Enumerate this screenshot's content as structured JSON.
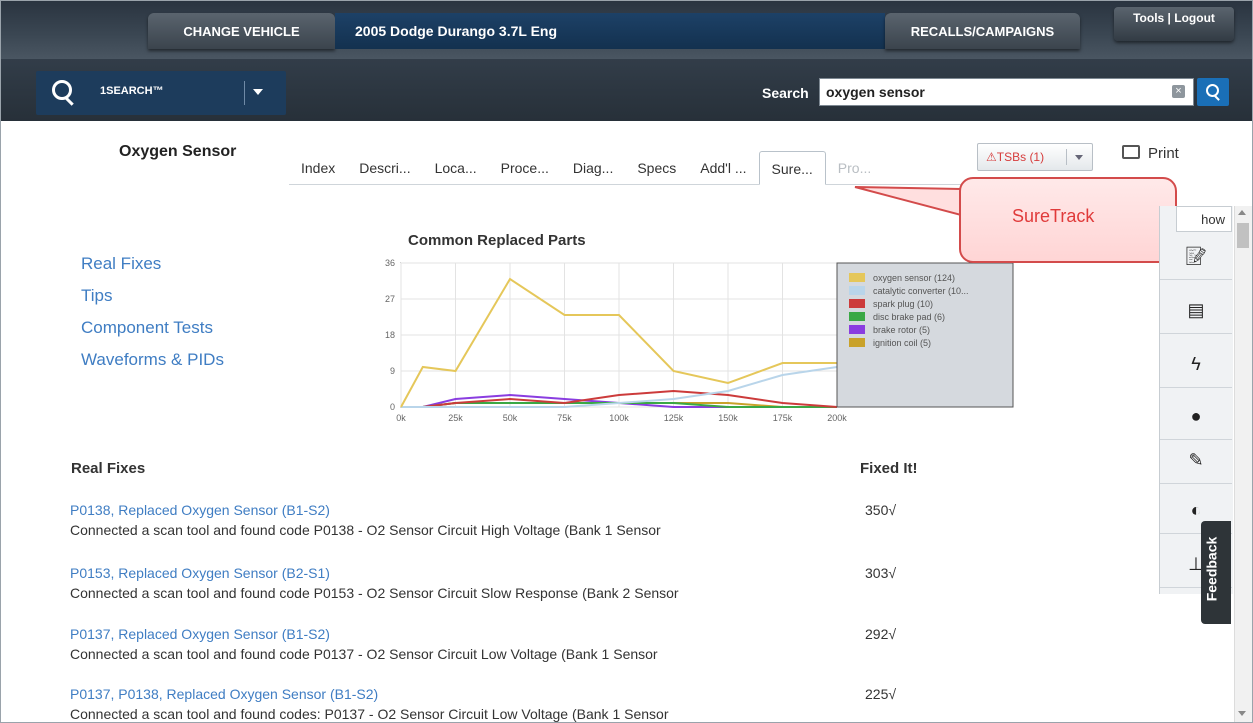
{
  "header": {
    "change_vehicle": "CHANGE VEHICLE",
    "vehicle": "2005 Dodge Durango 3.7L Eng",
    "recalls": "RECALLS/CAMPAIGNS",
    "tools_logout": "Tools | Logout"
  },
  "search": {
    "onesearch_label": "1SEARCH™",
    "label": "Search",
    "value": "oxygen sensor",
    "clear_icon": "close-icon",
    "button_icon": "search-icon"
  },
  "page": {
    "title": "Oxygen Sensor",
    "tabs": [
      "Index",
      "Descri...",
      "Loca...",
      "Proce...",
      "Diag...",
      "Specs",
      "Add'l ...",
      "Sure...",
      "Pro..."
    ],
    "active_tab": "Sure...",
    "tsbs_label": "TSBs (1)",
    "print_label": "Print"
  },
  "callout": {
    "text": "SureTrack"
  },
  "left_links": [
    "Real Fixes",
    "Tips",
    "Component Tests",
    "Waveforms & PIDs"
  ],
  "right_toolbar": {
    "show_label": "how",
    "icons": [
      "notes-icon",
      "document-icon",
      "flash-icon",
      "fluid-drop-icon",
      "edit-icon",
      "half-circle-icon",
      "hierarchy-icon"
    ],
    "feedback_label": "Feedback"
  },
  "chart_data": {
    "type": "line",
    "title": "Common Replaced Parts",
    "x": [
      0,
      10,
      25,
      50,
      75,
      100,
      125,
      150,
      175,
      200
    ],
    "xticks": [
      "0k",
      "25k",
      "50k",
      "75k",
      "100k",
      "125k",
      "150k",
      "175k",
      "200k"
    ],
    "xlim": [
      0,
      200
    ],
    "ylim": [
      0,
      36
    ],
    "yticks": [
      0,
      9,
      18,
      27,
      36
    ],
    "grid": true,
    "legend_position": "right",
    "series": [
      {
        "name": "oxygen sensor (124)",
        "color": "#e5c75a",
        "values": [
          0,
          10,
          9,
          32,
          23,
          23,
          9,
          6,
          11,
          11
        ]
      },
      {
        "name": "catalytic converter (10...",
        "color": "#b9d5ea",
        "values": [
          0,
          0,
          0,
          0,
          0,
          1,
          2,
          4,
          8,
          10
        ]
      },
      {
        "name": "spark plug (10)",
        "color": "#cc3b3b",
        "values": [
          0,
          0,
          1,
          2,
          1,
          3,
          4,
          3,
          1,
          0
        ]
      },
      {
        "name": "disc brake pad (6)",
        "color": "#3aa845",
        "values": [
          0,
          0,
          1,
          1,
          1,
          1,
          1,
          0,
          0,
          0
        ]
      },
      {
        "name": "brake rotor (5)",
        "color": "#8a3de0",
        "values": [
          0,
          0,
          2,
          3,
          2,
          1,
          0,
          0,
          0,
          0
        ]
      },
      {
        "name": "ignition coil (5)",
        "color": "#c9a22a",
        "values": [
          0,
          0,
          1,
          1,
          1,
          1,
          1,
          1,
          0,
          0
        ]
      }
    ]
  },
  "fixes": {
    "header": "Real Fixes",
    "fixed_header": "Fixed It!",
    "rows": [
      {
        "title": "P0138, Replaced Oxygen Sensor (B1-S2)",
        "desc": "Connected a scan tool and found code P0138 - O2 Sensor Circuit High Voltage (Bank 1 Sensor",
        "count": "350√"
      },
      {
        "title": "P0153, Replaced Oxygen Sensor (B2-S1)",
        "desc": "Connected a scan tool and found code P0153 - O2 Sensor Circuit Slow Response (Bank 2 Sensor",
        "count": "303√"
      },
      {
        "title": "P0137, Replaced Oxygen Sensor (B1-S2)",
        "desc": "Connected a scan tool and found code P0137 - O2 Sensor Circuit Low Voltage (Bank 1 Sensor",
        "count": "292√"
      },
      {
        "title": "P0137, P0138, Replaced Oxygen Sensor (B1-S2)",
        "desc": "Connected a scan tool and found codes: P0137 - O2 Sensor Circuit Low Voltage (Bank 1 Sensor",
        "count": "225√"
      }
    ]
  }
}
